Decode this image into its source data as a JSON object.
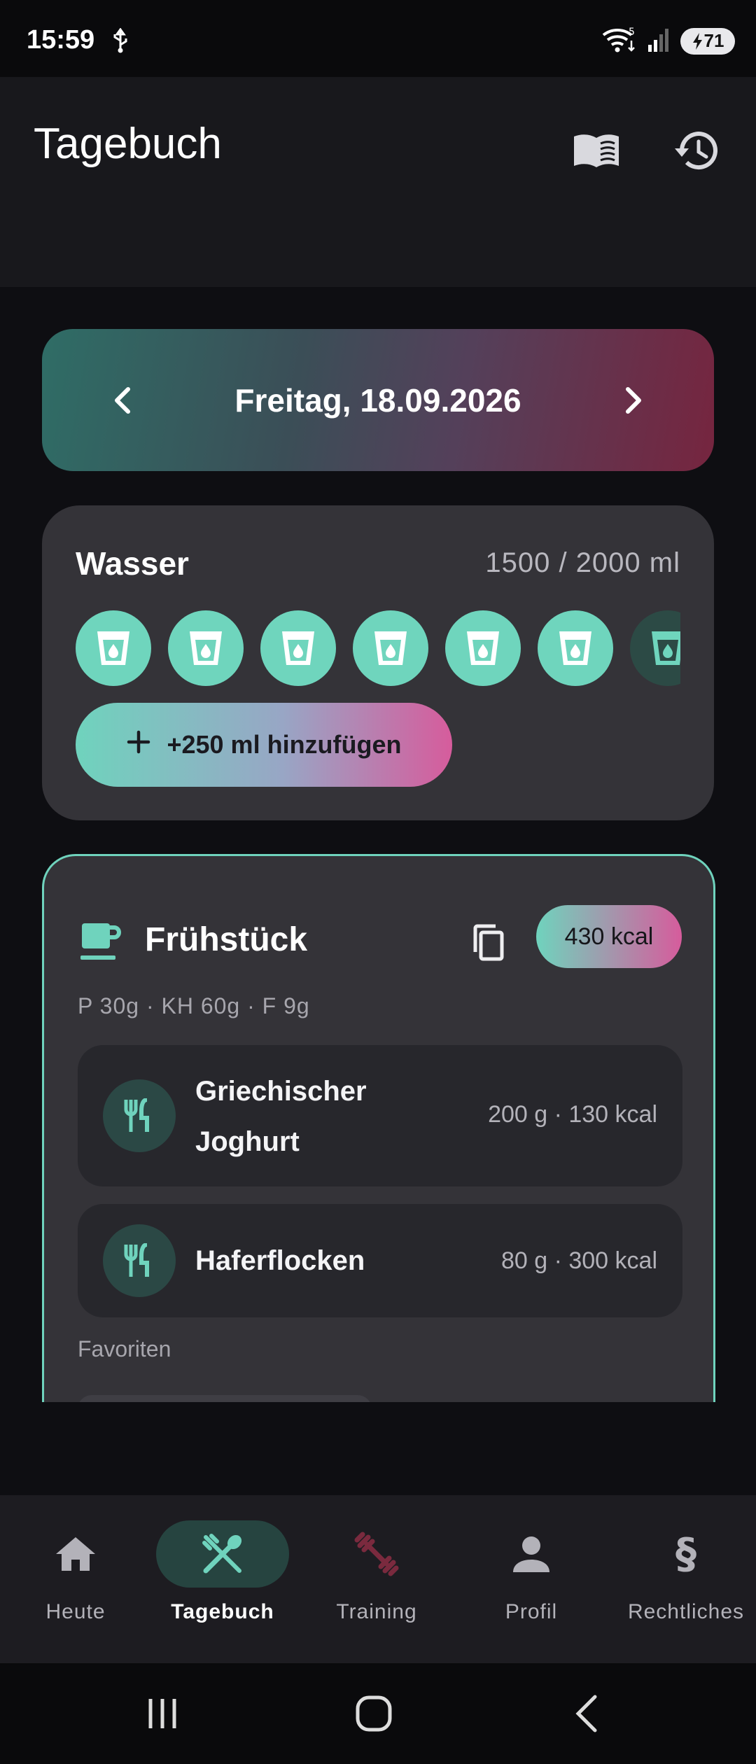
{
  "status_bar": {
    "time": "15:59",
    "battery": "71"
  },
  "header": {
    "title": "Tagebuch"
  },
  "date_nav": {
    "date": "Freitag, 18.09.2026"
  },
  "water": {
    "title": "Wasser",
    "amount": "1500 / 2000 ml",
    "add_button": "+250 ml hinzufügen",
    "filled_glasses": 6
  },
  "meal": {
    "title": "Frühstück",
    "kcal": "430 kcal",
    "macros": "P 30g · KH 60g · F 9g",
    "items": [
      {
        "name_line1": "Griechischer",
        "name_line2": "Joghurt",
        "meta": "200 g · 130 kcal"
      },
      {
        "name_line1": "Haferflocken",
        "meta": "80 g · 300 kcal"
      }
    ],
    "favorites_label": "Favoriten"
  },
  "bottom_nav": {
    "items": [
      {
        "label": "Heute"
      },
      {
        "label": "Tagebuch"
      },
      {
        "label": "Training"
      },
      {
        "label": "Profil"
      },
      {
        "label": "Rechtliches"
      }
    ],
    "active": "Tagebuch"
  },
  "colors": {
    "accent": "#6fd3bd",
    "accent_pink": "#d65c9c",
    "training_icon": "#7a2a3e",
    "card": "#343338"
  },
  "icons": {
    "usb": "usb-icon",
    "wifi": "wifi-icon",
    "signal": "signal-icon",
    "book": "book-icon",
    "history": "history-icon",
    "cup": "cup-icon",
    "copy": "copy-icon",
    "cutlery": "cutlery-icon",
    "home": "home-icon",
    "dumbbell": "dumbbell-icon",
    "person": "person-icon",
    "paragraph": "paragraph-icon"
  }
}
